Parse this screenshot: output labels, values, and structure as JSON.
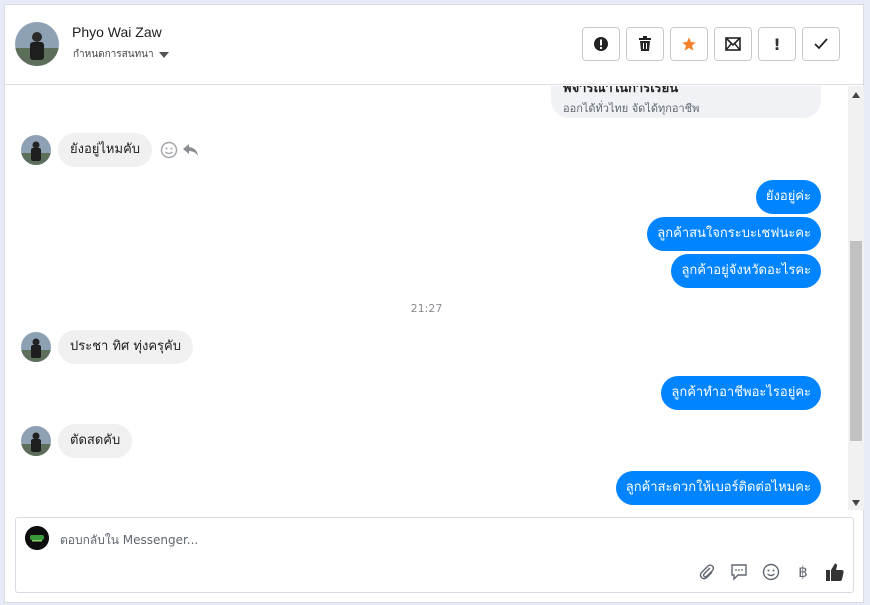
{
  "header": {
    "contact_name": "Phyo Wai Zaw",
    "contact_subtitle": "กำหนดการสนทนา",
    "actions": [
      "mark-spam",
      "delete",
      "star",
      "mark-unread",
      "follow-up",
      "done"
    ]
  },
  "conversation": {
    "card": {
      "title": "พิจารณาในการเรียน",
      "subtitle": "ออกได้ทั่วไทย จัดได้ทุกอาชีพ"
    },
    "messages": [
      {
        "dir": "in",
        "text": "ยังอยู่ไหมคับ"
      },
      {
        "dir": "out",
        "text": "ยังอยู่ค่ะ"
      },
      {
        "dir": "out",
        "text": "ลูกค้าสนใจกระบะเชฟนะคะ"
      },
      {
        "dir": "out",
        "text": "ลูกค้าอยู่จังหวัดอะไรคะ"
      },
      {
        "dir": "in",
        "text": "ประชา ทิศ ทุ่งครุคับ"
      },
      {
        "dir": "out",
        "text": "ลูกค้าทำอาชีพอะไรอยู่คะ"
      },
      {
        "dir": "in",
        "text": "ตัดสดคับ"
      },
      {
        "dir": "out",
        "text": "ลูกค้าสะดวกให้เบอร์ติดต่อไหมคะ"
      }
    ],
    "timestamp": "21:27"
  },
  "composer": {
    "placeholder": "ตอบกลับใน Messenger...",
    "icons": [
      "paperclip-icon",
      "saved-reply-icon",
      "emoji-icon",
      "baht-icon",
      "thumbs-up-icon"
    ]
  },
  "colors": {
    "outgoing_bubble": "#0084ff",
    "incoming_bubble": "#f0f0f0",
    "star": "#f5822a"
  }
}
